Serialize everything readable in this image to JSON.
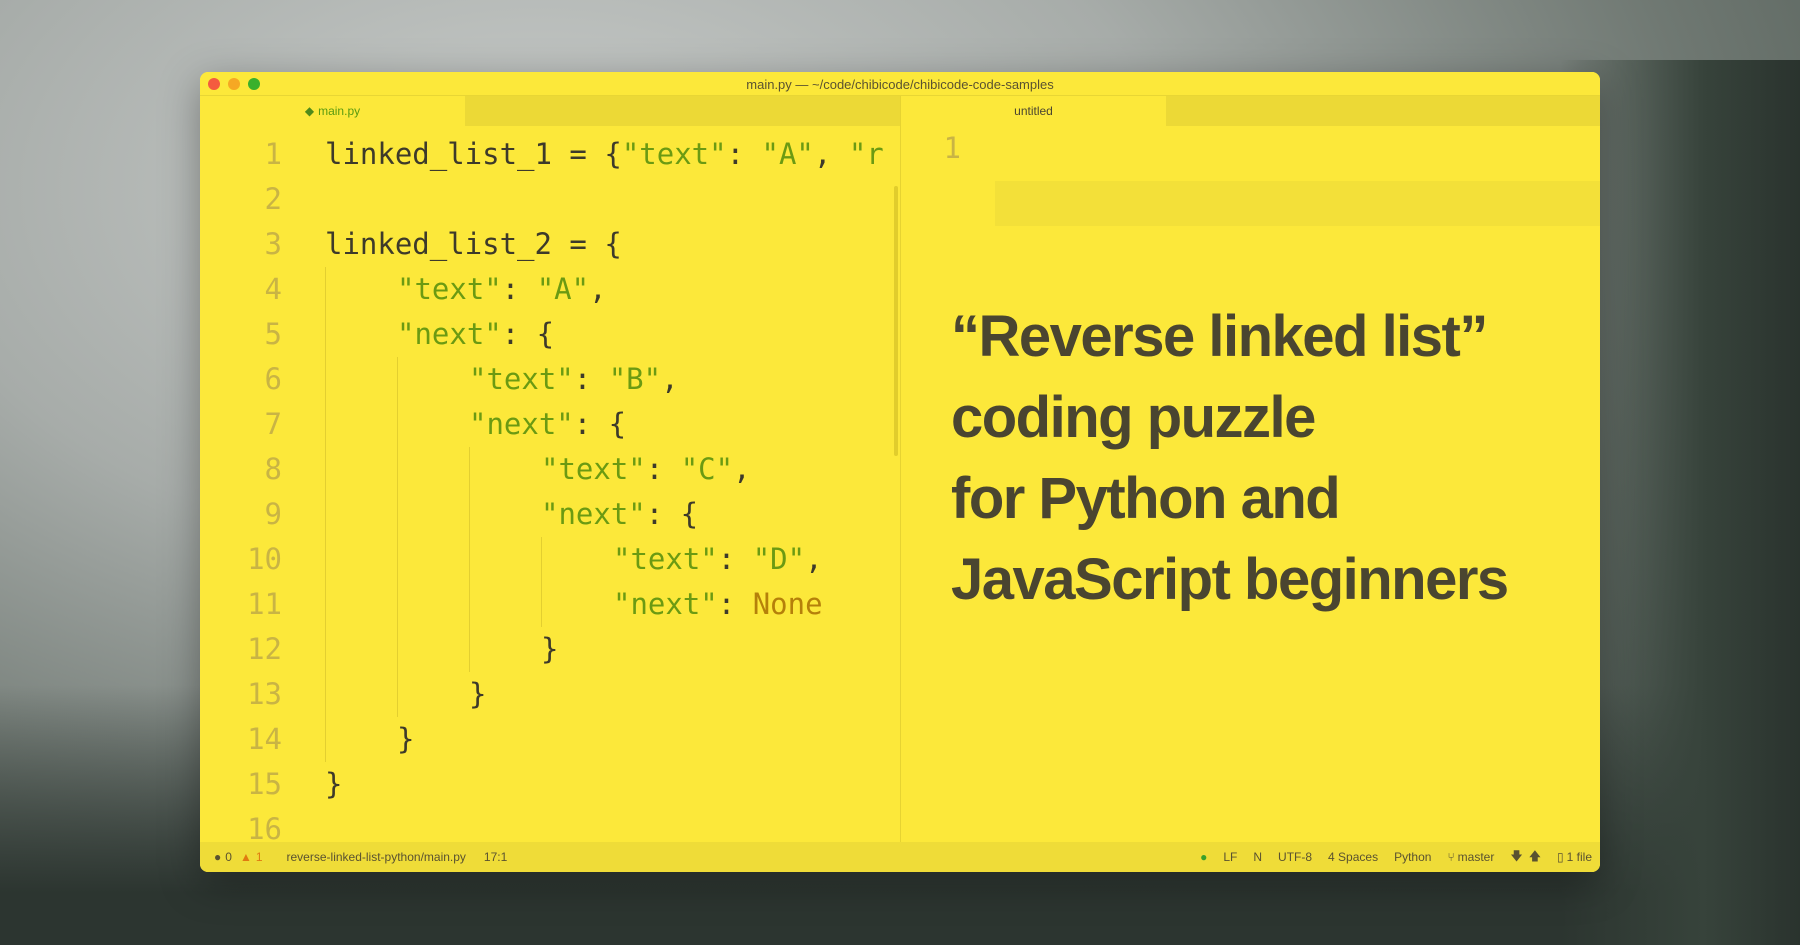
{
  "window": {
    "title": "main.py — ~/code/chibicode/chibicode-code-samples"
  },
  "tabs": {
    "left": {
      "label": "main.py",
      "icon": "python-icon"
    },
    "right": {
      "label": "untitled"
    }
  },
  "editor_left": {
    "lines": [
      {
        "n": "1",
        "indent": 0,
        "parts": [
          [
            "c",
            "linked_list_1 = {"
          ],
          [
            "s",
            "\"text\""
          ],
          [
            "c",
            ": "
          ],
          [
            "s",
            "\"A\""
          ],
          [
            "c",
            ", "
          ],
          [
            "s",
            "\"r"
          ]
        ]
      },
      {
        "n": "2",
        "indent": 0,
        "parts": []
      },
      {
        "n": "3",
        "indent": 0,
        "parts": [
          [
            "c",
            "linked_list_2 = {"
          ]
        ]
      },
      {
        "n": "4",
        "indent": 1,
        "parts": [
          [
            "s",
            "\"text\""
          ],
          [
            "c",
            ": "
          ],
          [
            "s",
            "\"A\""
          ],
          [
            "c",
            ","
          ]
        ]
      },
      {
        "n": "5",
        "indent": 1,
        "parts": [
          [
            "s",
            "\"next\""
          ],
          [
            "c",
            ": {"
          ]
        ]
      },
      {
        "n": "6",
        "indent": 2,
        "parts": [
          [
            "s",
            "\"text\""
          ],
          [
            "c",
            ": "
          ],
          [
            "s",
            "\"B\""
          ],
          [
            "c",
            ","
          ]
        ]
      },
      {
        "n": "7",
        "indent": 2,
        "parts": [
          [
            "s",
            "\"next\""
          ],
          [
            "c",
            ": {"
          ]
        ]
      },
      {
        "n": "8",
        "indent": 3,
        "parts": [
          [
            "s",
            "\"text\""
          ],
          [
            "c",
            ": "
          ],
          [
            "s",
            "\"C\""
          ],
          [
            "c",
            ","
          ]
        ]
      },
      {
        "n": "9",
        "indent": 3,
        "parts": [
          [
            "s",
            "\"next\""
          ],
          [
            "c",
            ": {"
          ]
        ]
      },
      {
        "n": "10",
        "indent": 4,
        "parts": [
          [
            "s",
            "\"text\""
          ],
          [
            "c",
            ": "
          ],
          [
            "s",
            "\"D\""
          ],
          [
            "c",
            ","
          ]
        ]
      },
      {
        "n": "11",
        "indent": 4,
        "parts": [
          [
            "s",
            "\"next\""
          ],
          [
            "c",
            ": "
          ],
          [
            "k",
            "None"
          ]
        ]
      },
      {
        "n": "12",
        "indent": 3,
        "parts": [
          [
            "c",
            "}"
          ]
        ]
      },
      {
        "n": "13",
        "indent": 2,
        "parts": [
          [
            "c",
            "}"
          ]
        ]
      },
      {
        "n": "14",
        "indent": 1,
        "parts": [
          [
            "c",
            "}"
          ]
        ]
      },
      {
        "n": "15",
        "indent": 0,
        "parts": [
          [
            "c",
            "}"
          ]
        ]
      },
      {
        "n": "16",
        "indent": 0,
        "parts": []
      }
    ]
  },
  "editor_right": {
    "line_number": "1"
  },
  "headline": [
    "“Reverse linked list”",
    "coding puzzle",
    "for Python and",
    "JavaScript beginners"
  ],
  "status": {
    "errors": "0",
    "warnings": "1",
    "path": "reverse-linked-list-python/main.py",
    "cursor": "17:1",
    "line_ending": "LF",
    "n": "N",
    "encoding": "UTF-8",
    "indent": "4 Spaces",
    "language": "Python",
    "branch": "master",
    "files": "1 file"
  },
  "colors": {
    "window": "#fce83a",
    "string": "#6b9a12",
    "keyword": "#b5800a",
    "text": "#3d3a2a"
  }
}
